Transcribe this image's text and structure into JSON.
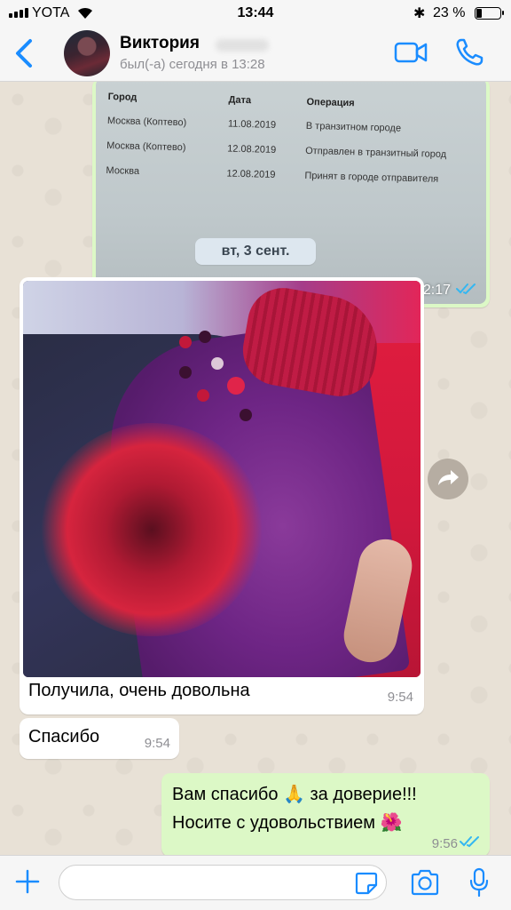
{
  "status_bar": {
    "carrier": "YOTA",
    "time": "13:44",
    "battery_percent": "23 %",
    "battery_level": 0.23
  },
  "header": {
    "back_icon": "chevron-left-icon",
    "contact_name": "Виктория",
    "last_seen": "был(-а) сегодня в 13:28",
    "video_icon": "video-camera-icon",
    "call_icon": "phone-icon",
    "accent_color": "#1a8cff"
  },
  "messages": {
    "doc_photo": {
      "table_headers": [
        "Город",
        "Дата",
        "Операция"
      ],
      "table_rows": [
        [
          "Москва (Коптево)",
          "11.08.2019",
          "В транзитном городе"
        ],
        [
          "Москва (Коптево)",
          "12.08.2019",
          "Отправлен в транзитный город"
        ],
        [
          "Москва",
          "12.08.2019",
          "Принят в городе отправителя"
        ]
      ],
      "time": "12:17",
      "status": "read"
    },
    "date_separator": "вт, 3 сент.",
    "photo_message": {
      "caption": "Получила, очень довольна",
      "time": "9:54"
    },
    "thanks_message": {
      "text": "Спасибо",
      "time": "9:54"
    },
    "reply_message": {
      "line1": "Вам спасибо 🙏 за доверие!!!",
      "line2": "Носите с удовольствием 🌺",
      "time": "9:56",
      "status": "read"
    }
  },
  "input_bar": {
    "placeholder": "",
    "value": ""
  },
  "colors": {
    "outgoing_bubble": "#dcf8c6",
    "incoming_bubble": "#ffffff",
    "read_ticks": "#34b7f1"
  }
}
